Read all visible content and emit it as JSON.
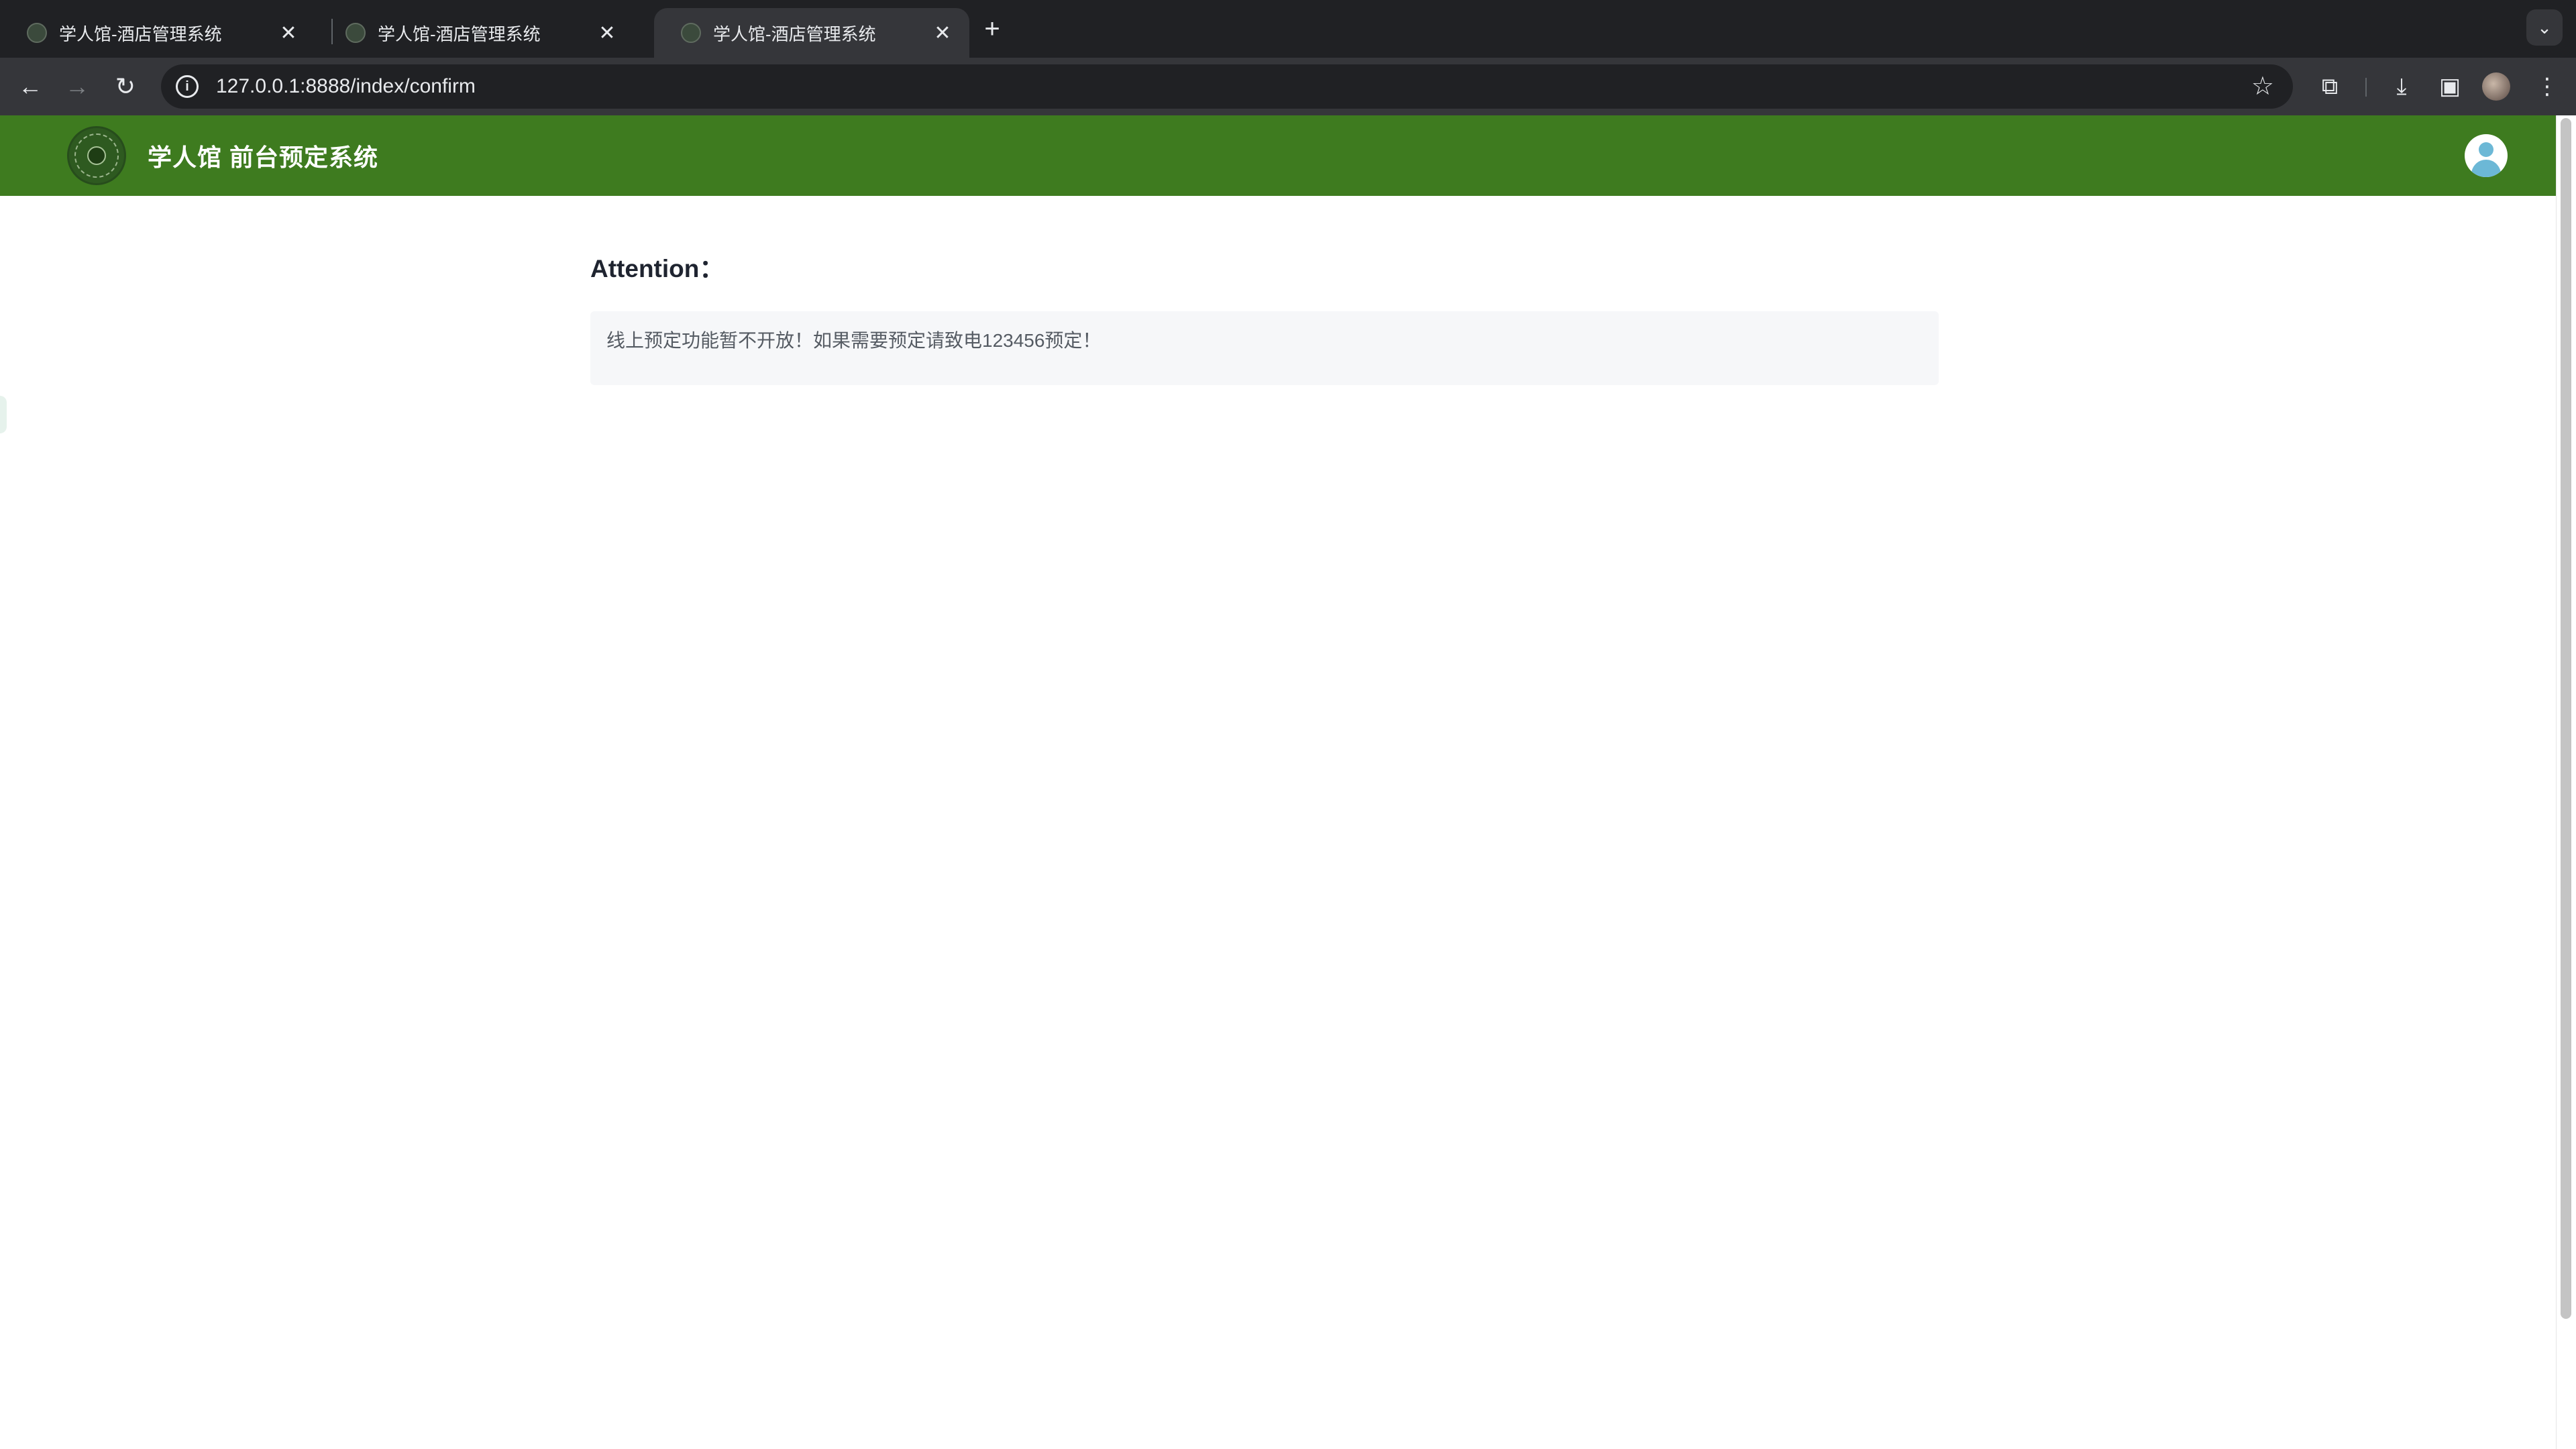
{
  "browser": {
    "tabs": [
      {
        "title": "学人馆-酒店管理系统",
        "active": false
      },
      {
        "title": "学人馆-酒店管理系统",
        "active": false
      },
      {
        "title": "学人馆-酒店管理系统",
        "active": true
      }
    ],
    "url": "127.0.0.1:8888/index/confirm",
    "icons": {
      "back": "back-arrow-icon",
      "forward": "forward-arrow-icon",
      "reload": "reload-icon",
      "site_info": "info-icon",
      "bookmark": "star-icon",
      "extensions": "puzzle-icon",
      "downloads": "download-icon",
      "side_panel": "side-panel-icon",
      "menu": "kebab-menu-icon",
      "tab_search": "chevron-down-icon",
      "new_tab": "plus-icon",
      "tab_close": "close-icon"
    }
  },
  "header": {
    "title": "学人馆 前台预定系统",
    "background_color": "#3e7b1f"
  },
  "main": {
    "attention_title": "Attention：",
    "notice_text": "线上预定功能暂不开放！如果需要预定请致电123456预定！"
  }
}
